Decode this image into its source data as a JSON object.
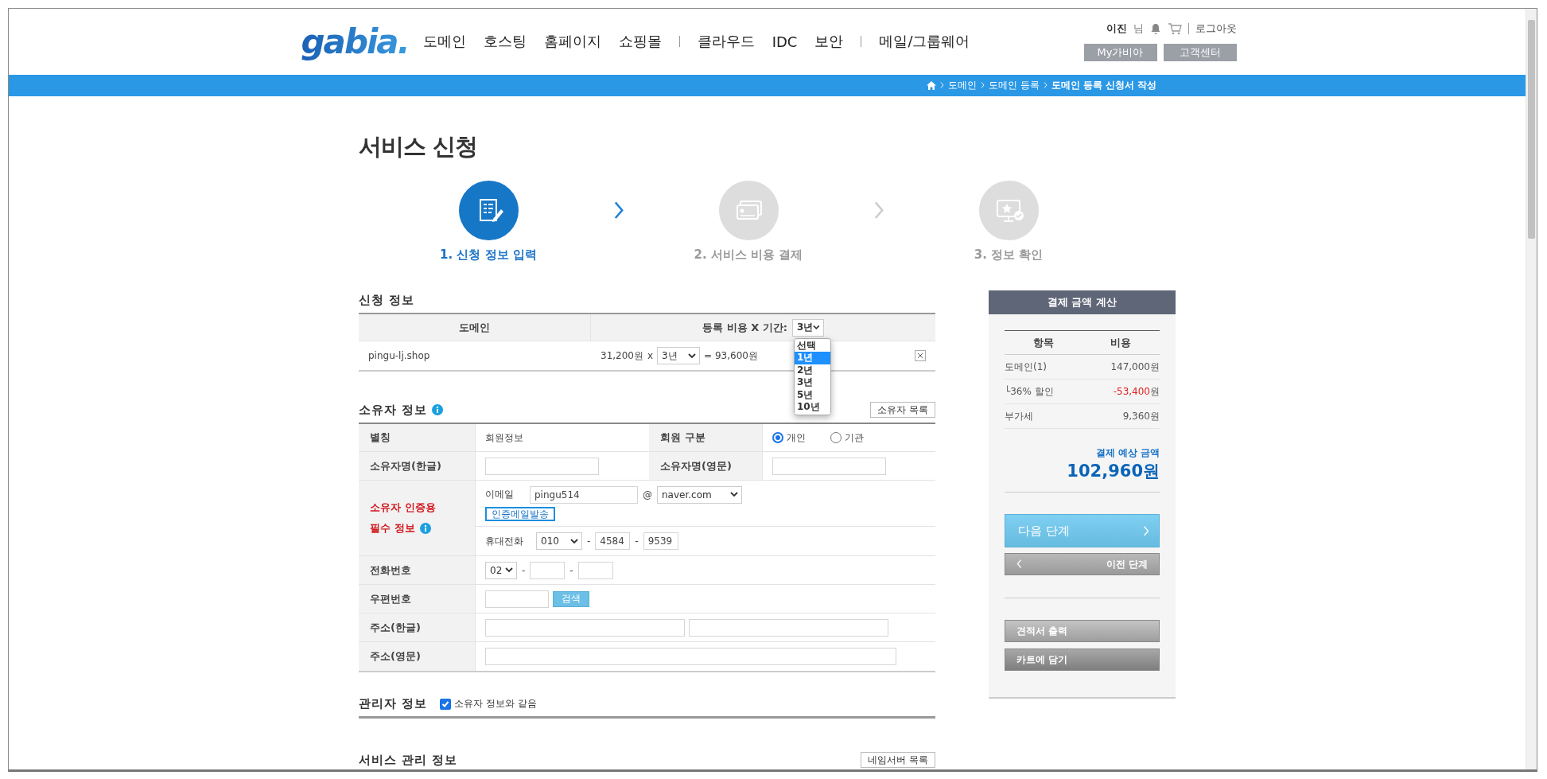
{
  "header": {
    "logo": "gabia.",
    "nav_groups": [
      [
        "도메인",
        "호스팅",
        "홈페이지",
        "쇼핑몰"
      ],
      [
        "클라우드",
        "IDC",
        "보안"
      ],
      [
        "메일/그룹웨어"
      ]
    ],
    "user": {
      "name": "이진",
      "suffix": "님",
      "logout": "로그아웃"
    },
    "buttons": [
      "My가비아",
      "고객센터"
    ]
  },
  "breadcrumb": [
    "도메인",
    "도메인 등록",
    "도메인 등록 신청서 작성"
  ],
  "page_title": "서비스 신청",
  "steps": [
    {
      "label": "1. 신청 정보 입력",
      "kind": "form",
      "selected": true
    },
    {
      "label": "2. 서비스 비용 결제",
      "kind": "card",
      "selected": false
    },
    {
      "label": "3. 정보 확인",
      "kind": "monitor",
      "selected": false
    }
  ],
  "application": {
    "title": "신청 정보",
    "columns": [
      "도메인",
      "등록 비용 X 기간:"
    ],
    "header_period": "3년",
    "dropdown": [
      {
        "label": "선택",
        "selected": false
      },
      {
        "label": "1년",
        "selected": true
      },
      {
        "label": "2년",
        "selected": false
      },
      {
        "label": "3년",
        "selected": false
      },
      {
        "label": "5년",
        "selected": false
      },
      {
        "label": "10년",
        "selected": false
      }
    ],
    "rows": [
      {
        "domain": "pingu-lj.shop",
        "price": "31,200원",
        "times": "x",
        "period": "3년",
        "result": "= 93,600원"
      }
    ]
  },
  "owner": {
    "title": "소유자 정보",
    "list_button": "소유자 목록",
    "alias_label": "별칭",
    "alias_value": "회원정보",
    "member_type_label": "회원 구분",
    "member_types": [
      {
        "label": "개인",
        "selected": true
      },
      {
        "label": "기관",
        "selected": false
      }
    ],
    "name_kr_label": "소유자명(한글)",
    "name_en_label": "소유자명(영문)",
    "verify_label": [
      "소유자 인증용",
      "필수 정보"
    ],
    "email_label": "이메일",
    "email_id": "pingu514",
    "at": "@",
    "email_domain": "naver.com",
    "send_button": "인증메일발송",
    "mobile_label": "휴대전화",
    "mobile": [
      {
        "kind": "select",
        "text": "010"
      },
      {
        "kind": "sep",
        "text": "-"
      },
      {
        "kind": "input",
        "text": "4584"
      },
      {
        "kind": "sep",
        "text": "-"
      },
      {
        "kind": "input",
        "text": "9539"
      }
    ],
    "phone_label": "전화번호",
    "phone": [
      {
        "kind": "select",
        "text": "02"
      },
      {
        "kind": "sep",
        "text": "-"
      },
      {
        "kind": "input"
      },
      {
        "kind": "sep",
        "text": "-"
      },
      {
        "kind": "input"
      }
    ],
    "postcode_label": "우편번호",
    "search_button": "검색",
    "addr_kr_label": "주소(한글)",
    "addr_en_label": "주소(영문)"
  },
  "manager": {
    "title": "관리자 정보",
    "same_as_owner": {
      "label": "소유자 정보와 같음",
      "checked": true
    }
  },
  "service": {
    "title": "서비스 관리 정보",
    "button": "네임서버 목록"
  },
  "summary": {
    "title": "결제 금액 계산",
    "columns": [
      "항목",
      "비용"
    ],
    "rows": [
      {
        "label": "도메인(1)",
        "amount": "147,000",
        "unit": "원",
        "kind": "normal"
      },
      {
        "label": "└36% 할인",
        "amount": "-53,400",
        "unit": "원",
        "kind": "discount"
      },
      {
        "label": "부가세",
        "amount": "9,360",
        "unit": "원",
        "kind": "normal"
      }
    ],
    "total_label": "결제 예상 금액",
    "total_value": "102,960원",
    "next_button": "다음 단계",
    "prev_button": "이전 단계",
    "quote_button": "견적서 출력",
    "cart_button": "카트에 담기"
  }
}
